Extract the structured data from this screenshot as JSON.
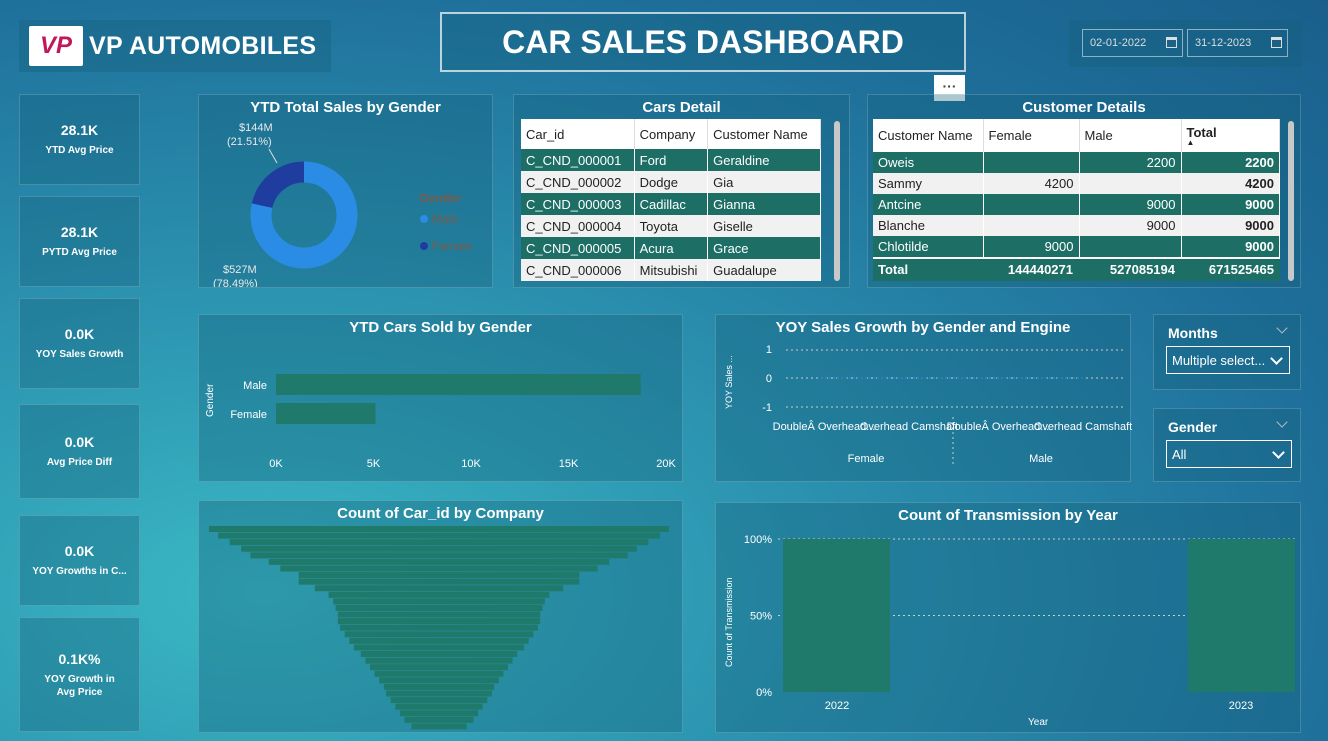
{
  "brand": {
    "logo_text": "VP",
    "name": "VP AUTOMOBILES"
  },
  "dashboard_title": "CAR SALES DASHBOARD",
  "dates": {
    "start": "02-01-2022",
    "end": "31-12-2023"
  },
  "more_label": "···",
  "kpis": [
    {
      "value": "28.1K",
      "label": "YTD Avg Price"
    },
    {
      "value": "28.1K",
      "label": "PYTD Avg Price"
    },
    {
      "value": "0.0K",
      "label": "YOY Sales Growth"
    },
    {
      "value": "0.0K",
      "label": "Avg Price Diff"
    },
    {
      "value": "0.0K",
      "label": "YOY Growths in C..."
    },
    {
      "value": "0.1K%",
      "label": "YOY Growth in Avg Price"
    }
  ],
  "donut": {
    "title": "YTD Total Sales by Gender",
    "legend_title": "Gender",
    "male_label": "Male",
    "female_label": "Female",
    "female_value": "$144M",
    "female_pct": "(21.51%)",
    "male_value": "$527M",
    "male_pct": "(78.49%)",
    "colors": {
      "male": "#2b8ce6",
      "female": "#1f3d9e"
    }
  },
  "cars_detail": {
    "title": "Cars Detail",
    "headers": [
      "Car_id",
      "Company",
      "Customer Name"
    ],
    "rows": [
      [
        "C_CND_000001",
        "Ford",
        "Geraldine"
      ],
      [
        "C_CND_000002",
        "Dodge",
        "Gia"
      ],
      [
        "C_CND_000003",
        "Cadillac",
        "Gianna"
      ],
      [
        "C_CND_000004",
        "Toyota",
        "Giselle"
      ],
      [
        "C_CND_000005",
        "Acura",
        "Grace"
      ],
      [
        "C_CND_000006",
        "Mitsubishi",
        "Guadalupe"
      ]
    ]
  },
  "customer_details": {
    "title": "Customer Details",
    "headers": [
      "Customer Name",
      "Female",
      "Male",
      "Total"
    ],
    "rows": [
      [
        "Oweis",
        "",
        "2200",
        "2200"
      ],
      [
        "Sammy",
        "4200",
        "",
        "4200"
      ],
      [
        "Antcine",
        "",
        "9000",
        "9000"
      ],
      [
        "Blanche",
        "",
        "9000",
        "9000"
      ],
      [
        "Chlotilde",
        "9000",
        "",
        "9000"
      ]
    ],
    "total": [
      "Total",
      "144440271",
      "527085194",
      "671525465"
    ]
  },
  "bar_gender": {
    "title": "YTD Cars Sold by Gender",
    "ylabel": "Gender",
    "ticks": [
      "0K",
      "5K",
      "10K",
      "15K",
      "20K"
    ],
    "chart_data": {
      "type": "bar",
      "categories": [
        "Male",
        "Female"
      ],
      "values": [
        18700,
        5100
      ],
      "xlim": [
        0,
        20000
      ]
    }
  },
  "yoy": {
    "title": "YOY Sales Growth by Gender and Engine",
    "ylabel": "YOY Sales ...",
    "yticks": [
      "1",
      "0",
      "-1"
    ],
    "engines": [
      {
        "name": "DoubleÂ Overhead...",
        "gender": "Female"
      },
      {
        "name": "Overhead Camshaft",
        "gender": "Female"
      },
      {
        "name": "DoubleÂ Overhead...",
        "gender": "Male"
      },
      {
        "name": "Overhead Camshaft",
        "gender": "Male"
      }
    ],
    "groups": [
      "Female",
      "Male"
    ]
  },
  "months_slicer": {
    "label": "Months",
    "value": "Multiple select..."
  },
  "gender_slicer": {
    "label": "Gender",
    "value": "All"
  },
  "funnel": {
    "title": "Count of Car_id by Company",
    "chart_data": {
      "type": "bar",
      "values": [
        100,
        96,
        91,
        86,
        82,
        74,
        69,
        61,
        61,
        54,
        48,
        46,
        45,
        44,
        44,
        43,
        41,
        39,
        37,
        34,
        32,
        30,
        28,
        26,
        24,
        23,
        21,
        19,
        17,
        15,
        12
      ]
    }
  },
  "transmission": {
    "title": "Count of Transmission by Year",
    "ylabel": "Count of Transmission",
    "xlabel": "Year",
    "yticks": [
      "100%",
      "50%",
      "0%"
    ],
    "chart_data": {
      "type": "bar",
      "categories": [
        "2022",
        "2023"
      ],
      "values": [
        100,
        100
      ],
      "ylim": [
        0,
        100
      ]
    }
  }
}
